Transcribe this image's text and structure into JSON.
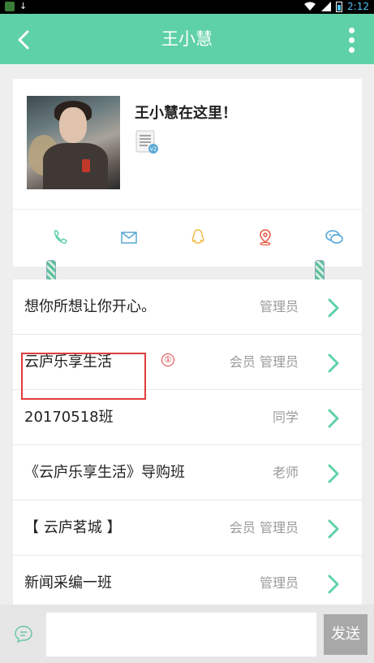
{
  "status_bar": {
    "time": "2:12"
  },
  "header": {
    "title": "王小慧"
  },
  "profile": {
    "name": "王小慧在这里！",
    "doc_badge": "v2"
  },
  "contact_icons": [
    {
      "icon": "phone-icon",
      "color": "#5fd1a6"
    },
    {
      "icon": "mail-icon",
      "color": "#5aa9d6"
    },
    {
      "icon": "qq-icon",
      "color": "#f4b63f"
    },
    {
      "icon": "location-icon",
      "color": "#e8553f"
    },
    {
      "icon": "wechat-icon",
      "color": "#4aa3d9"
    }
  ],
  "groups": [
    {
      "name": "想你所想让你开心。",
      "roles": "管理员"
    },
    {
      "name": "云庐乐享生活",
      "roles": "会员  管理员"
    },
    {
      "name": "20170518班",
      "roles": "同学"
    },
    {
      "name": "《云庐乐享生活》导购班",
      "roles": "老师"
    },
    {
      "name": "【 云庐茗城 】",
      "roles": "会员  管理员"
    },
    {
      "name": "新闻采编一班",
      "roles": "管理员"
    }
  ],
  "annotation": {
    "marker": "①",
    "color": "#e03c3c"
  },
  "input_bar": {
    "placeholder": "",
    "send_label": "发送"
  },
  "theme": {
    "accent": "#5fd1a6",
    "chevron": "#5fd1a6"
  }
}
